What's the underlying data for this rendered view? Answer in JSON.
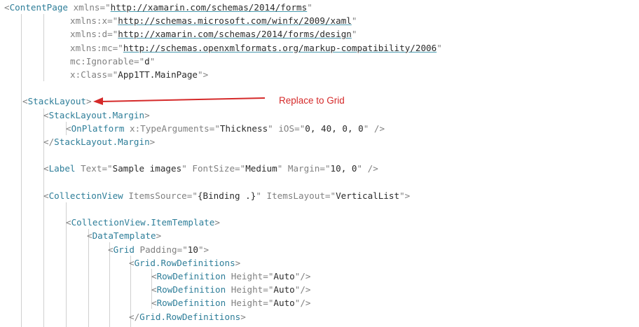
{
  "annotation": {
    "text": "Replace to Grid",
    "color": "#d52a2a"
  },
  "colors": {
    "tag": "#2e7e99",
    "attribute": "#808080",
    "value": "#2b2b2b",
    "punctuation": "#808080",
    "background": "#ffffff"
  },
  "code_lines": [
    [
      {
        "t": "<",
        "k": "punc"
      },
      {
        "t": "ContentPage",
        "k": "tag"
      },
      {
        "t": " xmlns",
        "k": "attr"
      },
      {
        "t": "=\"",
        "k": "punc"
      },
      {
        "t": "http://xamarin.com/schemas/2014/forms",
        "k": "link"
      },
      {
        "t": "\"",
        "k": "punc"
      }
    ],
    [
      {
        "t": "xmlns:x",
        "k": "attr"
      },
      {
        "t": "=\"",
        "k": "punc"
      },
      {
        "t": "http://schemas.microsoft.com/winfx/2009/xaml",
        "k": "link"
      },
      {
        "t": "\"",
        "k": "punc"
      }
    ],
    [
      {
        "t": "xmlns:d",
        "k": "attr"
      },
      {
        "t": "=\"",
        "k": "punc"
      },
      {
        "t": "http://xamarin.com/schemas/2014/forms/design",
        "k": "link"
      },
      {
        "t": "\"",
        "k": "punc"
      }
    ],
    [
      {
        "t": "xmlns:mc",
        "k": "attr"
      },
      {
        "t": "=\"",
        "k": "punc"
      },
      {
        "t": "http://schemas.openxmlformats.org/markup-compatibility/2006",
        "k": "link"
      },
      {
        "t": "\"",
        "k": "punc"
      }
    ],
    [
      {
        "t": "mc:Ignorable",
        "k": "attr"
      },
      {
        "t": "=\"",
        "k": "punc"
      },
      {
        "t": "d",
        "k": "val"
      },
      {
        "t": "\"",
        "k": "punc"
      }
    ],
    [
      {
        "t": "x:Class",
        "k": "attr"
      },
      {
        "t": "=\"",
        "k": "punc"
      },
      {
        "t": "App1TT.MainPage",
        "k": "val"
      },
      {
        "t": "\">",
        "k": "punc"
      }
    ],
    [],
    [
      {
        "t": "<",
        "k": "punc"
      },
      {
        "t": "StackLayout",
        "k": "tag"
      },
      {
        "t": ">",
        "k": "punc"
      }
    ],
    [
      {
        "t": "<",
        "k": "punc"
      },
      {
        "t": "StackLayout.Margin",
        "k": "tag"
      },
      {
        "t": ">",
        "k": "punc"
      }
    ],
    [
      {
        "t": "<",
        "k": "punc"
      },
      {
        "t": "OnPlatform",
        "k": "tag"
      },
      {
        "t": " x:TypeArguments",
        "k": "attr"
      },
      {
        "t": "=\"",
        "k": "punc"
      },
      {
        "t": "Thickness",
        "k": "val"
      },
      {
        "t": "\"",
        "k": "punc"
      },
      {
        "t": " iOS",
        "k": "attr"
      },
      {
        "t": "=\"",
        "k": "punc"
      },
      {
        "t": "0, 40, 0, 0",
        "k": "val"
      },
      {
        "t": "\"",
        "k": "punc"
      },
      {
        "t": " />",
        "k": "punc"
      }
    ],
    [
      {
        "t": "</",
        "k": "punc"
      },
      {
        "t": "StackLayout.Margin",
        "k": "tag"
      },
      {
        "t": ">",
        "k": "punc"
      }
    ],
    [],
    [
      {
        "t": "<",
        "k": "punc"
      },
      {
        "t": "Label",
        "k": "tag"
      },
      {
        "t": " Text",
        "k": "attr"
      },
      {
        "t": "=\"",
        "k": "punc"
      },
      {
        "t": "Sample images",
        "k": "val"
      },
      {
        "t": "\"",
        "k": "punc"
      },
      {
        "t": " FontSize",
        "k": "attr"
      },
      {
        "t": "=\"",
        "k": "punc"
      },
      {
        "t": "Medium",
        "k": "val"
      },
      {
        "t": "\"",
        "k": "punc"
      },
      {
        "t": " Margin",
        "k": "attr"
      },
      {
        "t": "=\"",
        "k": "punc"
      },
      {
        "t": "10, 0",
        "k": "val"
      },
      {
        "t": "\"",
        "k": "punc"
      },
      {
        "t": " />",
        "k": "punc"
      }
    ],
    [],
    [
      {
        "t": "<",
        "k": "punc"
      },
      {
        "t": "CollectionView",
        "k": "tag"
      },
      {
        "t": " ItemsSource",
        "k": "attr"
      },
      {
        "t": "=\"",
        "k": "punc"
      },
      {
        "t": "{Binding .}",
        "k": "val"
      },
      {
        "t": "\"",
        "k": "punc"
      },
      {
        "t": " ItemsLayout",
        "k": "attr"
      },
      {
        "t": "=\"",
        "k": "punc"
      },
      {
        "t": "VerticalList",
        "k": "val"
      },
      {
        "t": "\">",
        "k": "punc"
      }
    ],
    [],
    [
      {
        "t": "<",
        "k": "punc"
      },
      {
        "t": "CollectionView.ItemTemplate",
        "k": "tag"
      },
      {
        "t": ">",
        "k": "punc"
      }
    ],
    [
      {
        "t": "<",
        "k": "punc"
      },
      {
        "t": "DataTemplate",
        "k": "tag"
      },
      {
        "t": ">",
        "k": "punc"
      }
    ],
    [
      {
        "t": "<",
        "k": "punc"
      },
      {
        "t": "Grid",
        "k": "tag"
      },
      {
        "t": " Padding",
        "k": "attr"
      },
      {
        "t": "=\"",
        "k": "punc"
      },
      {
        "t": "10",
        "k": "val"
      },
      {
        "t": "\">",
        "k": "punc"
      }
    ],
    [
      {
        "t": "<",
        "k": "punc"
      },
      {
        "t": "Grid.RowDefinitions",
        "k": "tag"
      },
      {
        "t": ">",
        "k": "punc"
      }
    ],
    [
      {
        "t": "<",
        "k": "punc"
      },
      {
        "t": "RowDefinition",
        "k": "tag"
      },
      {
        "t": " Height",
        "k": "attr"
      },
      {
        "t": "=\"",
        "k": "punc"
      },
      {
        "t": "Auto",
        "k": "val"
      },
      {
        "t": "\"/>",
        "k": "punc"
      }
    ],
    [
      {
        "t": "<",
        "k": "punc"
      },
      {
        "t": "RowDefinition",
        "k": "tag"
      },
      {
        "t": " Height",
        "k": "attr"
      },
      {
        "t": "=\"",
        "k": "punc"
      },
      {
        "t": "Auto",
        "k": "val"
      },
      {
        "t": "\"/>",
        "k": "punc"
      }
    ],
    [
      {
        "t": "<",
        "k": "punc"
      },
      {
        "t": "RowDefinition",
        "k": "tag"
      },
      {
        "t": " Height",
        "k": "attr"
      },
      {
        "t": "=\"",
        "k": "punc"
      },
      {
        "t": "Auto",
        "k": "val"
      },
      {
        "t": "\"/>",
        "k": "punc"
      }
    ],
    [
      {
        "t": "</",
        "k": "punc"
      },
      {
        "t": "Grid.RowDefinitions",
        "k": "tag"
      },
      {
        "t": ">",
        "k": "punc"
      }
    ]
  ]
}
